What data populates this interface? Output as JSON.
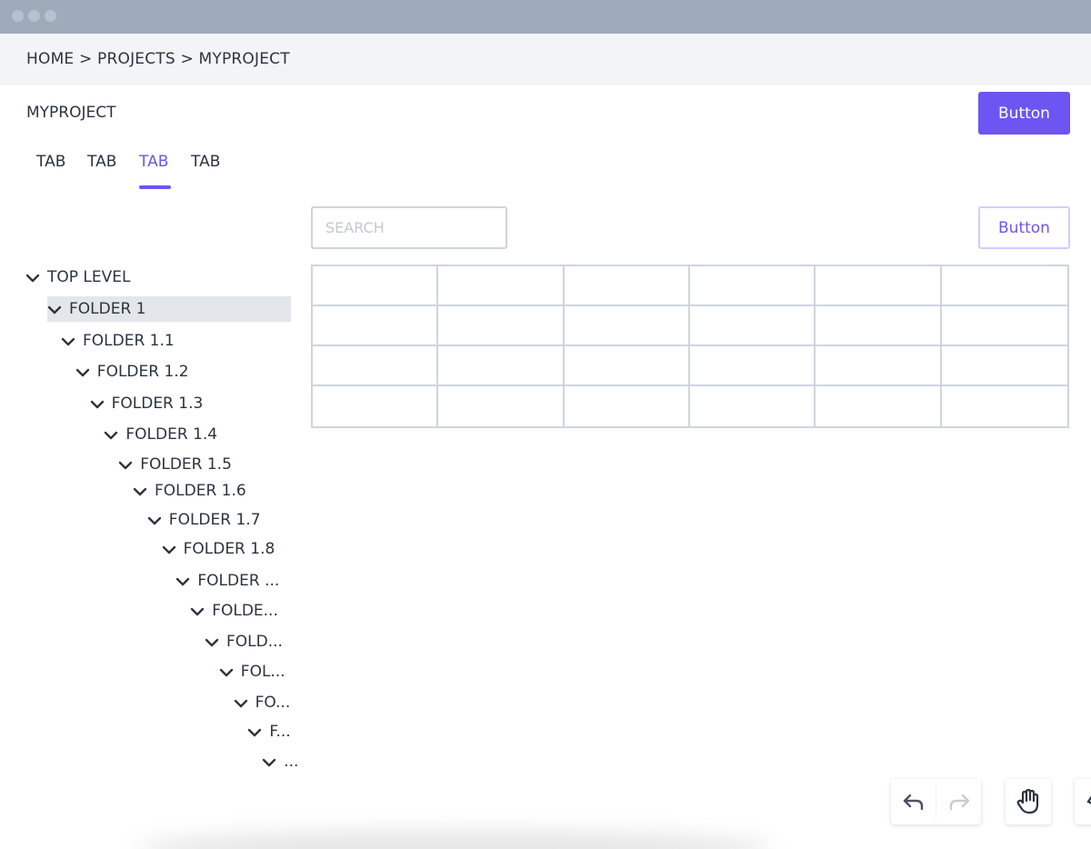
{
  "breadcrumb": {
    "text": "HOME > PROJECTS > MYPROJECT"
  },
  "header": {
    "title": "MYPROJECT",
    "primary_button": "Button"
  },
  "tabs": [
    {
      "label": "TAB",
      "active": false
    },
    {
      "label": "TAB",
      "active": false
    },
    {
      "label": "TAB",
      "active": true
    },
    {
      "label": "TAB",
      "active": false
    }
  ],
  "toolbar": {
    "search_placeholder": "SEARCH",
    "secondary_button": "Button"
  },
  "tree": [
    {
      "label": "TOP LEVEL",
      "selected": false
    },
    {
      "label": "FOLDER 1",
      "selected": true
    },
    {
      "label": "FOLDER 1.1",
      "selected": false
    },
    {
      "label": "FOLDER 1.2",
      "selected": false
    },
    {
      "label": "FOLDER 1.3",
      "selected": false
    },
    {
      "label": "FOLDER 1.4",
      "selected": false
    },
    {
      "label": "FOLDER 1.5",
      "selected": false
    },
    {
      "label": "FOLDER 1.6",
      "selected": false
    },
    {
      "label": "FOLDER 1.7",
      "selected": false
    },
    {
      "label": "FOLDER 1.8",
      "selected": false
    },
    {
      "label": "FOLDER ...",
      "selected": false
    },
    {
      "label": "FOLDE...",
      "selected": false
    },
    {
      "label": "FOLD...",
      "selected": false
    },
    {
      "label": "FOL...",
      "selected": false
    },
    {
      "label": "FO...",
      "selected": false
    },
    {
      "label": "F...",
      "selected": false
    },
    {
      "label": "...",
      "selected": false
    }
  ],
  "canvas_tools": [
    {
      "icon": "undo-icon"
    },
    {
      "icon": "redo-icon"
    },
    {
      "icon": "hand-icon"
    }
  ],
  "colors": {
    "accent": "#6c55f2",
    "titlebar": "#9eabbb",
    "border": "#ced5dd",
    "selected_row": "#e3e6ea"
  }
}
